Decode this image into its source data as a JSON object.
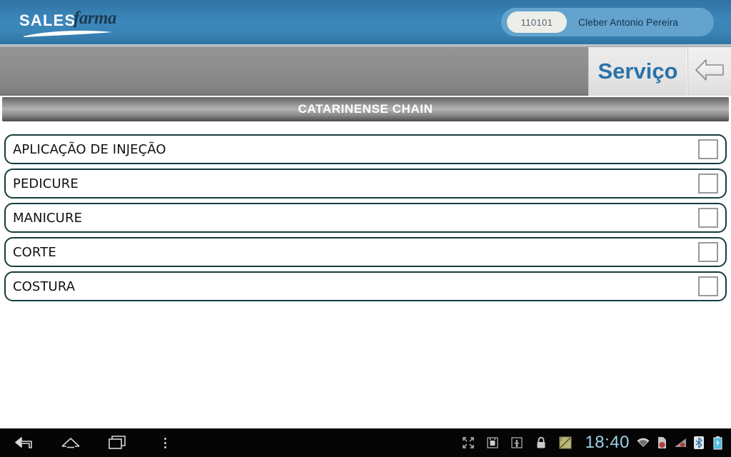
{
  "header": {
    "logo": {
      "primary": "SALES",
      "secondary": "farma",
      "swoosh_icon": "swoosh-underline-icon"
    },
    "user": {
      "id": "110101",
      "name": "Cleber Antonio Pereira"
    },
    "brand_color": "#3c87bb",
    "chip_color": "#63a3cd"
  },
  "toolbar": {
    "screen_title": "Serviço",
    "back_icon": "back-arrow-icon",
    "title_text_color": "#2a72a8"
  },
  "chain": {
    "title": "CATARINENSE CHAIN"
  },
  "list": {
    "items": [
      {
        "label": "APLICAÇÃO DE INJEÇÃO",
        "checked": false
      },
      {
        "label": "PEDICURE",
        "checked": false
      },
      {
        "label": "MANICURE",
        "checked": false
      },
      {
        "label": "CORTE",
        "checked": false
      },
      {
        "label": "COSTURA",
        "checked": false
      }
    ],
    "border_color": "#153c3c",
    "checkbox_icon": "checkbox-unchecked-icon"
  },
  "navbar": {
    "buttons": [
      {
        "name": "back-icon",
        "label": "Back"
      },
      {
        "name": "home-icon",
        "label": "Home"
      },
      {
        "name": "recents-icon",
        "label": "Recent apps"
      },
      {
        "name": "overflow-menu-icon",
        "label": "Menu"
      }
    ],
    "status_icons": [
      {
        "name": "fullscreen-icon"
      },
      {
        "name": "android-app-icon"
      },
      {
        "name": "usb-icon"
      },
      {
        "name": "lock-icon"
      },
      {
        "name": "notepad-icon"
      }
    ],
    "time": "18:40",
    "time_color": "#9fd2e8",
    "right_icons": [
      {
        "name": "wifi-icon"
      },
      {
        "name": "sd-card-icon"
      },
      {
        "name": "signal-icon"
      },
      {
        "name": "bluetooth-icon"
      },
      {
        "name": "battery-icon"
      }
    ]
  }
}
